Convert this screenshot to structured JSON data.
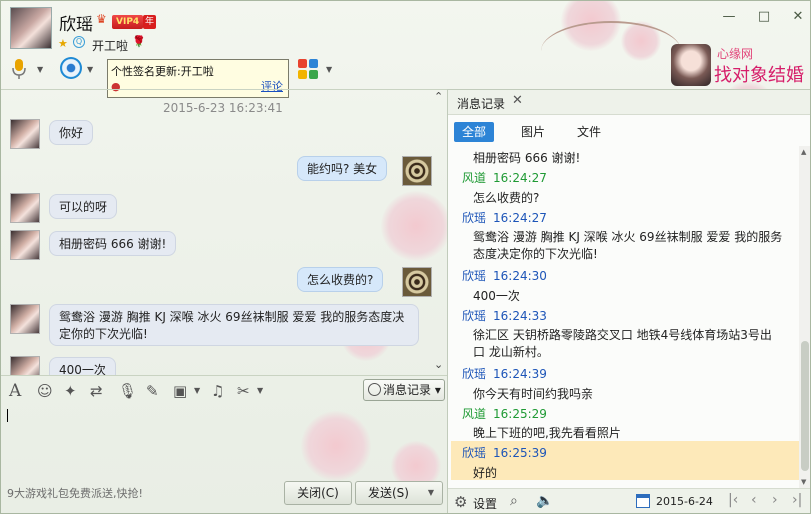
{
  "header": {
    "contact_name": "欣瑶",
    "vip_label": "VIP4",
    "year_label": "年",
    "status_text": "开工啦",
    "signature_tip": {
      "text": "个性签名更新:开工啦",
      "comment_link": "评论"
    }
  },
  "window_controls": {
    "minimize": "—",
    "maximize": "□",
    "close": "✕"
  },
  "ad": {
    "line1": "心缘网",
    "line2": "找对象结婚"
  },
  "chat": {
    "timestamp": "2015-6-23 16:23:41",
    "messages": [
      {
        "from": "her",
        "text": "你好"
      },
      {
        "from": "me",
        "text": "能约吗? 美女"
      },
      {
        "from": "her",
        "text": "可以的呀"
      },
      {
        "from": "her",
        "text": "相册密码 666 谢谢!"
      },
      {
        "from": "me",
        "text": "怎么收费的?"
      },
      {
        "from": "her",
        "text": "鸳鸯浴 漫游 胸推 KJ  深喉 冰火 69丝袜制服 爱爱  我的服务态度决定你的下次光临!"
      },
      {
        "from": "her",
        "text": "400一次"
      }
    ]
  },
  "input": {
    "history_button": "消息记录",
    "promo": "9大游戏礼包免费派送,快抢!",
    "close_button": "关闭(C)",
    "send_button": "发送(S)"
  },
  "history": {
    "title": "消息记录",
    "filters": [
      "全部",
      "图片",
      "文件"
    ],
    "entries": [
      {
        "type": "msg",
        "text": "相册密码 666 谢谢!"
      },
      {
        "type": "head",
        "who": "me",
        "name": "风道",
        "time": "16:24:27"
      },
      {
        "type": "msg",
        "text": "怎么收费的?"
      },
      {
        "type": "head",
        "who": "her",
        "name": "欣瑶",
        "time": "16:24:27"
      },
      {
        "type": "msg",
        "text": "鸳鸯浴 漫游 胸推 KJ 深喉 冰火 69丝袜制服 爱爱 我的服务态度决定你的下次光临!"
      },
      {
        "type": "head",
        "who": "her",
        "name": "欣瑶",
        "time": "16:24:30"
      },
      {
        "type": "msg",
        "text": "400一次"
      },
      {
        "type": "head",
        "who": "her",
        "name": "欣瑶",
        "time": "16:24:33"
      },
      {
        "type": "msg",
        "text": "徐汇区 天钥桥路零陵路交叉口 地铁4号线体育场站3号出口 龙山新村。"
      },
      {
        "type": "head",
        "who": "her",
        "name": "欣瑶",
        "time": "16:24:39"
      },
      {
        "type": "msg",
        "text": "你今天有时间约我吗亲"
      },
      {
        "type": "head",
        "who": "me",
        "name": "风道",
        "time": "16:25:29"
      },
      {
        "type": "msg",
        "text": "晚上下班的吧,我先看看照片"
      },
      {
        "type": "head",
        "who": "her",
        "name": "欣瑶",
        "time": "16:25:39"
      },
      {
        "type": "msg",
        "text": "好的"
      }
    ],
    "settings_label": "设置",
    "date": "2015-6-24"
  },
  "colors": {
    "accent_blue": "#2d84d6",
    "her_name": "#1d55b8",
    "me_name": "#1f9a34",
    "highlight": "#fde9b9",
    "vip_red": "#d81e1e"
  }
}
